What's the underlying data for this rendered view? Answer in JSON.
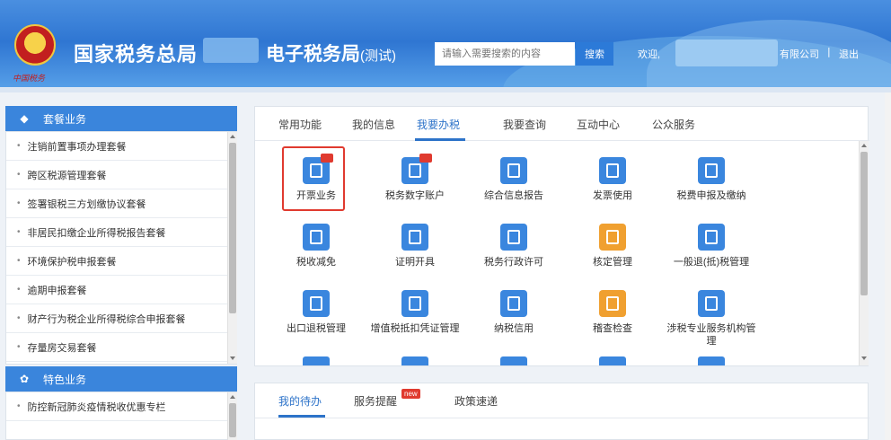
{
  "header": {
    "org_name": "国家税务总局",
    "system_name": "电子税务局",
    "system_suffix": "(测试)",
    "search_placeholder": "请输入需要搜索的内容",
    "search_button": "搜索",
    "welcome": "欢迎,",
    "company_suffix": "有限公司",
    "separator": "|",
    "logout": "退出",
    "emblem_text": "中国税务"
  },
  "sidebar": {
    "package_title": "套餐业务",
    "package_items": [
      "注销前置事项办理套餐",
      "跨区税源管理套餐",
      "签署银税三方划缴协议套餐",
      "非居民扣缴企业所得税报告套餐",
      "环境保护税申报套餐",
      "逾期申报套餐",
      "财产行为税企业所得税综合申报套餐",
      "存量房交易套餐"
    ],
    "special_title": "特色业务",
    "special_items": [
      "防控新冠肺炎疫情税收优惠专栏"
    ]
  },
  "main": {
    "tabs": [
      "常用功能",
      "我的信息",
      "我要办税",
      "我要查询",
      "互动中心",
      "公众服务"
    ],
    "active_tab": "我要办税",
    "grid": [
      {
        "label": "开票业务",
        "icon": "invoice-icon",
        "color": "#3a86de"
      },
      {
        "label": "税务数字账户",
        "icon": "digital-account-icon",
        "color": "#3a86de"
      },
      {
        "label": "综合信息报告",
        "icon": "info-report-icon",
        "color": "#3a86de"
      },
      {
        "label": "发票使用",
        "icon": "invoice-use-icon",
        "color": "#3a86de"
      },
      {
        "label": "税费申报及缴纳",
        "icon": "tax-declare-icon",
        "color": "#3a86de"
      },
      {
        "label": "税收减免",
        "icon": "tax-relief-icon",
        "color": "#3a86de"
      },
      {
        "label": "证明开具",
        "icon": "certificate-icon",
        "color": "#3a86de"
      },
      {
        "label": "税务行政许可",
        "icon": "permit-icon",
        "color": "#3a86de"
      },
      {
        "label": "核定管理",
        "icon": "assess-icon",
        "color": "#f0a030"
      },
      {
        "label": "一般退(抵)税管理",
        "icon": "refund-icon",
        "color": "#3a86de"
      },
      {
        "label": "出口退税管理",
        "icon": "export-refund-icon",
        "color": "#3a86de"
      },
      {
        "label": "增值税抵扣凭证管理",
        "icon": "vat-voucher-icon",
        "color": "#3a86de"
      },
      {
        "label": "纳税信用",
        "icon": "credit-icon",
        "color": "#3a86de"
      },
      {
        "label": "稽查检查",
        "icon": "inspection-icon",
        "color": "#f0a030"
      },
      {
        "label": "涉税专业服务机构管\n理",
        "icon": "agency-icon",
        "color": "#3a86de"
      }
    ]
  },
  "bottom": {
    "tabs": [
      "我的待办",
      "服务提醒",
      "政策速递"
    ],
    "new_badge": "new"
  }
}
